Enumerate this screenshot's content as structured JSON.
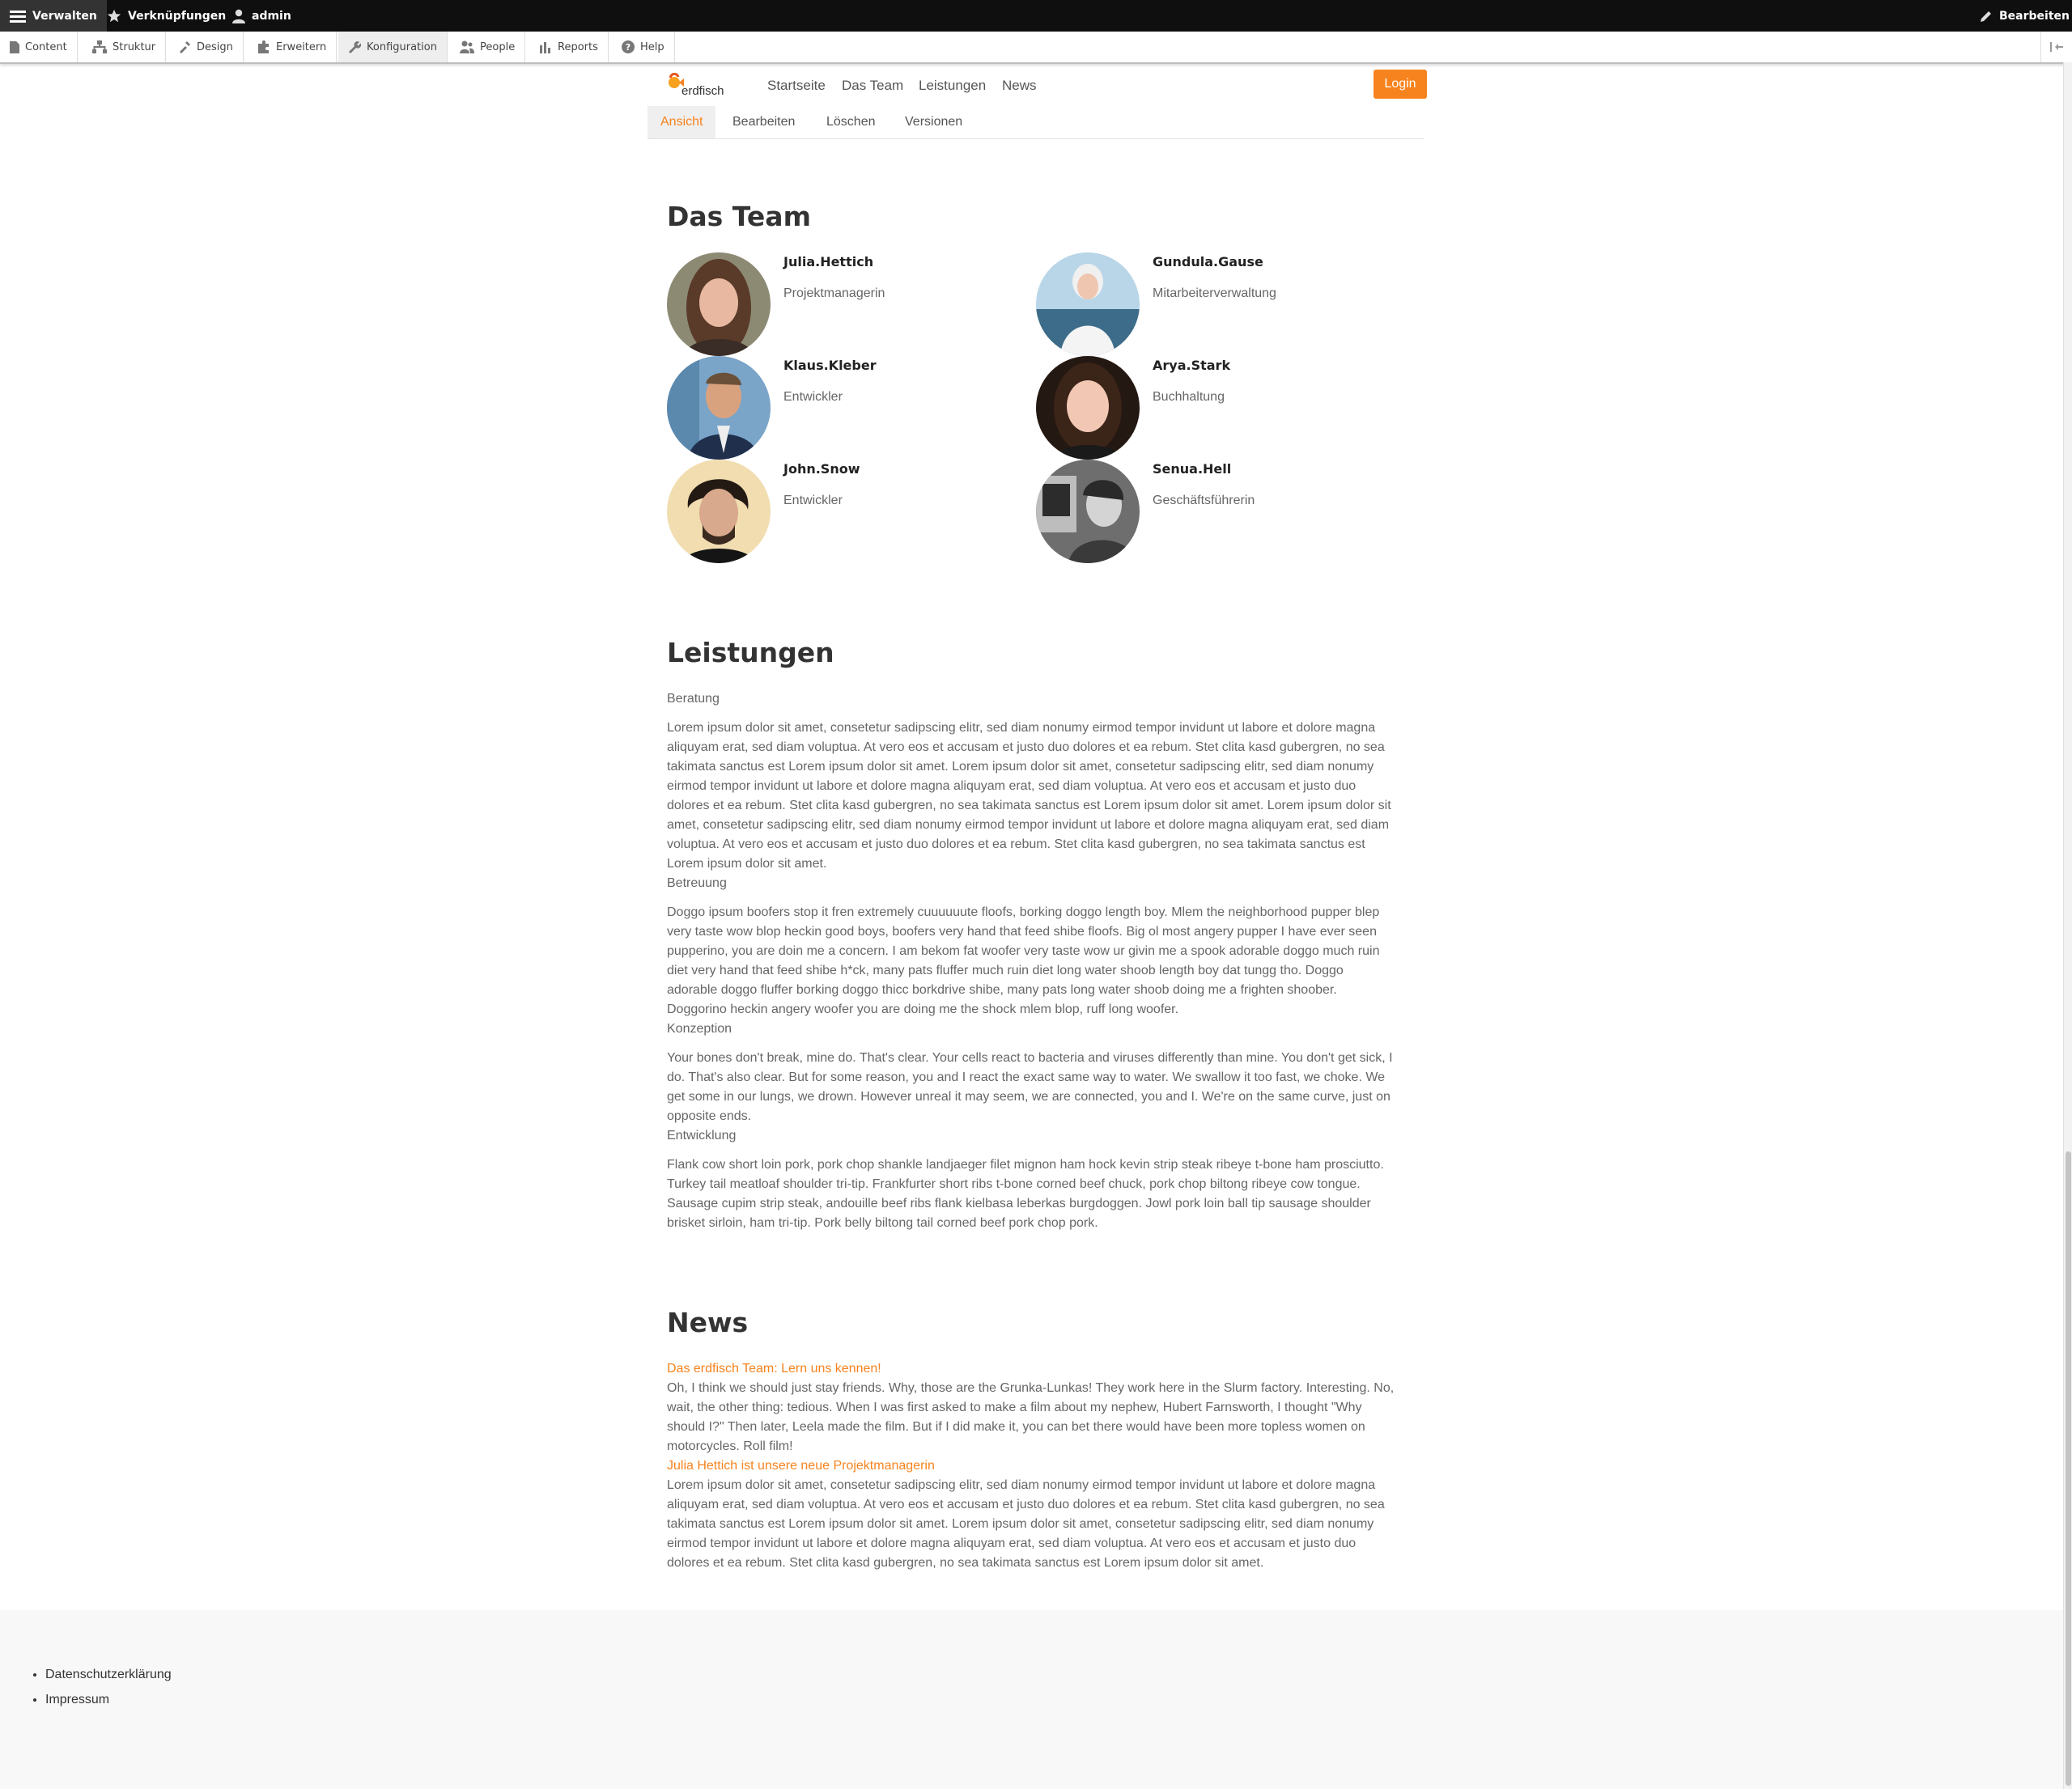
{
  "toolbar": {
    "manage": "Verwalten",
    "shortcuts": "Verknüpfungen",
    "user": "admin",
    "edit": "Bearbeiten"
  },
  "admin_menu": [
    "Content",
    "Struktur",
    "Design",
    "Erweitern",
    "Konfiguration",
    "People",
    "Reports",
    "Help"
  ],
  "site": {
    "logo_text": "erdfisch",
    "nav": [
      "Startseite",
      "Das Team",
      "Leistungen",
      "News"
    ],
    "login": "Login",
    "accent": "#f7831e"
  },
  "tabs": [
    "Ansicht",
    "Bearbeiten",
    "Löschen",
    "Versionen"
  ],
  "team": {
    "title": "Das Team",
    "members": [
      {
        "name": "Julia.Hettich",
        "role": "Projektmanagerin"
      },
      {
        "name": "Gundula.Gause",
        "role": "Mitarbeiterverwaltung"
      },
      {
        "name": "Klaus.Kleber",
        "role": "Entwickler"
      },
      {
        "name": "Arya.Stark",
        "role": "Buchhaltung"
      },
      {
        "name": "John.Snow",
        "role": "Entwickler"
      },
      {
        "name": "Senua.Hell",
        "role": "Geschäftsführerin"
      }
    ]
  },
  "services": {
    "title": "Leistungen",
    "items": [
      {
        "heading": "Beratung",
        "lines": [
          "Lorem ipsum dolor sit amet, consetetur sadipscing elitr, sed diam nonumy eirmod tempor invidunt ut labore et dolore magna",
          "aliquyam erat, sed diam voluptua. At vero eos et accusam et justo duo dolores et ea rebum. Stet clita kasd gubergren, no sea",
          "takimata sanctus est Lorem ipsum dolor sit amet. Lorem ipsum dolor sit amet, consetetur sadipscing elitr, sed diam nonumy",
          "eirmod tempor invidunt ut labore et dolore magna aliquyam erat, sed diam voluptua. At vero eos et accusam et justo duo",
          "dolores et ea rebum. Stet clita kasd gubergren, no sea takimata sanctus est Lorem ipsum dolor sit amet. Lorem ipsum dolor sit",
          "amet, consetetur sadipscing elitr, sed diam nonumy eirmod tempor invidunt ut labore et dolore magna aliquyam erat, sed diam",
          "voluptua. At vero eos et accusam et justo duo dolores et ea rebum. Stet clita kasd gubergren, no sea takimata sanctus est",
          "Lorem ipsum dolor sit amet."
        ]
      },
      {
        "heading": "Betreuung",
        "lines": [
          "Doggo ipsum boofers stop it fren extremely cuuuuuute floofs, borking doggo length boy. Mlem the neighborhood pupper blep",
          "very taste wow blop heckin good boys, boofers very hand that feed shibe floofs. Big ol most angery pupper I have ever seen",
          "pupperino, you are doin me a concern. I am bekom fat woofer very taste wow ur givin me a spook adorable doggo much ruin",
          "diet very hand that feed shibe h*ck, many pats fluffer much ruin diet long water shoob length boy dat tungg tho. Doggo",
          "adorable doggo fluffer borking doggo thicc borkdrive shibe, many pats long water shoob doing me a frighten shoober.",
          "Doggorino heckin angery woofer you are doing me the shock mlem blop, ruff long woofer."
        ]
      },
      {
        "heading": "Konzeption",
        "lines": [
          "Your bones don't break, mine do. That's clear. Your cells react to bacteria and viruses differently than mine. You don't get sick, I",
          "do. That's also clear. But for some reason, you and I react the exact same way to water. We swallow it too fast, we choke. We",
          "get some in our lungs, we drown. However unreal it may seem, we are connected, you and I. We're on the same curve, just on",
          "opposite ends."
        ]
      },
      {
        "heading": "Entwicklung",
        "lines": [
          "Flank cow short loin pork, pork chop shankle landjaeger filet mignon ham hock kevin strip steak ribeye t-bone ham prosciutto.",
          "Turkey tail meatloaf shoulder tri-tip. Frankfurter short ribs t-bone corned beef chuck, pork chop biltong ribeye cow tongue.",
          "Sausage cupim strip steak, andouille beef ribs flank kielbasa leberkas burgdoggen. Jowl pork loin ball tip sausage shoulder",
          "brisket sirloin, ham tri-tip. Pork belly biltong tail corned beef pork chop pork."
        ]
      }
    ]
  },
  "news": {
    "title": "News",
    "items": [
      {
        "link": "Das erdfisch Team: Lern uns kennen!",
        "lines": [
          "Oh, I think we should just stay friends. Why, those are the Grunka-Lunkas! They work here in the Slurm factory. Interesting. No,",
          "wait, the other thing: tedious. When I was first asked to make a film about my nephew, Hubert Farnsworth, I thought \"Why",
          "should I?\" Then later, Leela made the film. But if I did make it, you can bet there would have been more topless women on",
          "motorcycles. Roll film!"
        ]
      },
      {
        "link": "Julia Hettich ist unsere neue Projektmanagerin",
        "lines": [
          "Lorem ipsum dolor sit amet, consetetur sadipscing elitr, sed diam nonumy eirmod tempor invidunt ut labore et dolore magna",
          "aliquyam erat, sed diam voluptua. At vero eos et accusam et justo duo dolores et ea rebum. Stet clita kasd gubergren, no sea",
          "takimata sanctus est Lorem ipsum dolor sit amet. Lorem ipsum dolor sit amet, consetetur sadipscing elitr, sed diam nonumy",
          "eirmod tempor invidunt ut labore et dolore magna aliquyam erat, sed diam voluptua. At vero eos et accusam et justo duo",
          "dolores et ea rebum. Stet clita kasd gubergren, no sea takimata sanctus est Lorem ipsum dolor sit amet."
        ]
      }
    ]
  },
  "footer": {
    "links": [
      "Datenschutzerklärung",
      "Impressum"
    ]
  }
}
